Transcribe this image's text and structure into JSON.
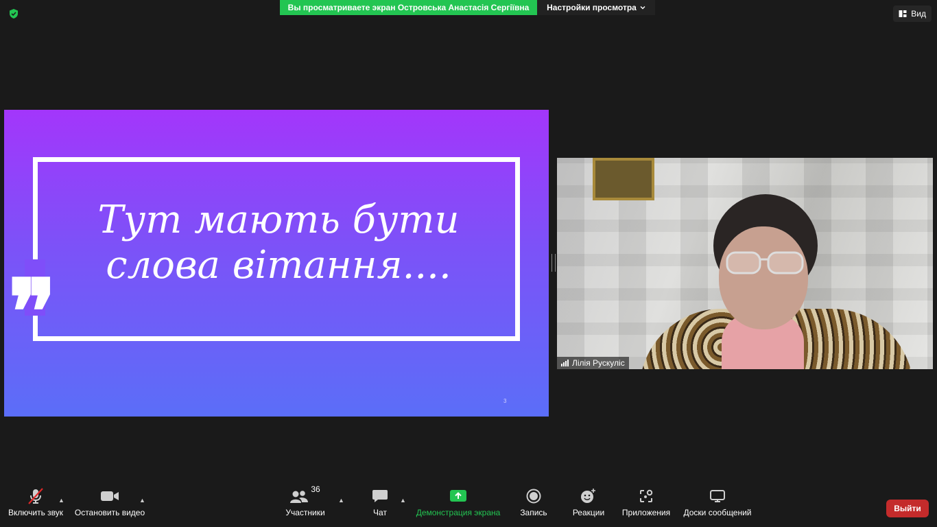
{
  "top_bar": {
    "share_banner": "Вы просматриваете экран Островська Анастасія Сергіївна",
    "view_settings": "Настройки просмотра",
    "view_button": "Вид"
  },
  "slide": {
    "line1": "Тут мають бути",
    "line2": "слова вітання....",
    "page_number": "3"
  },
  "participant": {
    "name": "Лілія Рускуліс"
  },
  "toolbar": {
    "unmute": "Включить звук",
    "stop_video": "Остановить видео",
    "participants": "Участники",
    "participants_count": "36",
    "chat": "Чат",
    "share_screen": "Демонстрация экрана",
    "record": "Запись",
    "reactions": "Реакции",
    "apps": "Приложения",
    "whiteboards": "Доски сообщений",
    "leave": "Выйти"
  },
  "colors": {
    "share_green": "#23c552",
    "leave_red": "#c42b2b",
    "slide_top": "#a336fb",
    "slide_bottom": "#5b6ef8"
  }
}
